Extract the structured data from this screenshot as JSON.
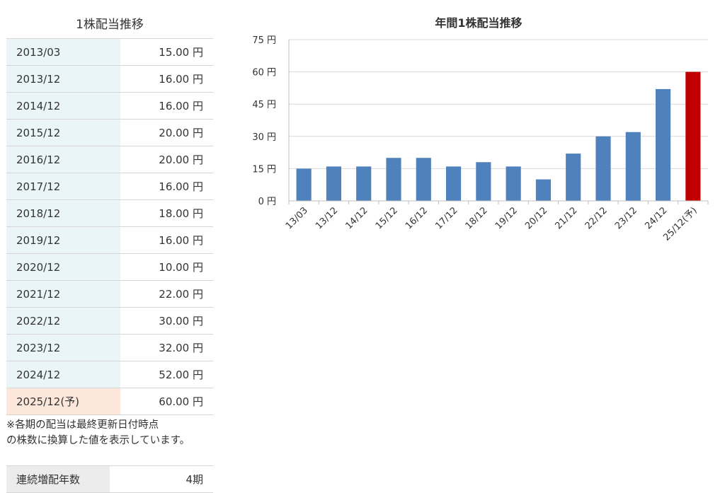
{
  "table": {
    "title": "1株配当推移",
    "rows": [
      {
        "period": "2013/03",
        "amount": "15.00 円"
      },
      {
        "period": "2013/12",
        "amount": "16.00 円"
      },
      {
        "period": "2014/12",
        "amount": "16.00 円"
      },
      {
        "period": "2015/12",
        "amount": "20.00 円"
      },
      {
        "period": "2016/12",
        "amount": "20.00 円"
      },
      {
        "period": "2017/12",
        "amount": "16.00 円"
      },
      {
        "period": "2018/12",
        "amount": "18.00 円"
      },
      {
        "period": "2019/12",
        "amount": "16.00 円"
      },
      {
        "period": "2020/12",
        "amount": "10.00 円"
      },
      {
        "period": "2021/12",
        "amount": "22.00 円"
      },
      {
        "period": "2022/12",
        "amount": "30.00 円"
      },
      {
        "period": "2023/12",
        "amount": "32.00 円"
      },
      {
        "period": "2024/12",
        "amount": "52.00 円"
      },
      {
        "period": "2025/12(予)",
        "amount": "60.00 円"
      }
    ],
    "note_line1": "※各期の配当は最終更新日付時点",
    "note_line2": "の株数に換算した値を表示しています。",
    "streak_label": "連続増配年数",
    "streak_value": "4期"
  },
  "colors": {
    "bar": "#4f81bd",
    "forecast_bar": "#c00000",
    "period_cell_bg": "#eaf5f8",
    "forecast_cell_bg": "#fde7da",
    "gridline": "#d9d9d9"
  },
  "chart_data": {
    "type": "bar",
    "title": "年間1株配当推移",
    "categories": [
      "13/03",
      "13/12",
      "14/12",
      "15/12",
      "16/12",
      "17/12",
      "18/12",
      "19/12",
      "20/12",
      "21/12",
      "22/12",
      "23/12",
      "24/12",
      "25/12(予)"
    ],
    "values": [
      15,
      16,
      16,
      20,
      20,
      16,
      18,
      16,
      10,
      22,
      30,
      32,
      52,
      60
    ],
    "forecast_index": 13,
    "ylim": [
      0,
      75
    ],
    "yticks": [
      0,
      15,
      30,
      45,
      60,
      75
    ],
    "ytick_unit": "円",
    "grid": true
  }
}
